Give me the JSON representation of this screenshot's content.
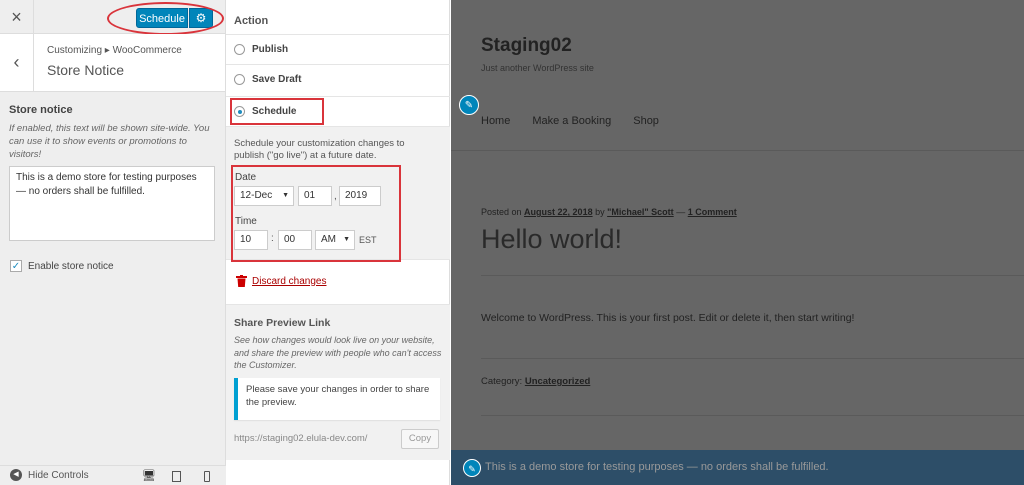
{
  "controls": {
    "close_icon": "×",
    "schedule_label": "Schedule",
    "gear_icon": "⚙",
    "back_icon": "‹",
    "breadcrumb": "Customizing ▸ WooCommerce",
    "section_title": "Store Notice",
    "store_notice_label": "Store notice",
    "store_notice_desc": "If enabled, this text will be shown site-wide. You can use it to show events or promotions to visitors!",
    "store_notice_value": "This is a demo store for testing purposes — no orders shall be fulfilled.",
    "enable_label": "Enable store notice",
    "enable_checked": true,
    "hide_controls_label": "Hide Controls"
  },
  "action": {
    "title": "Action",
    "options": [
      {
        "label": "Publish",
        "selected": false
      },
      {
        "label": "Save Draft",
        "selected": false
      },
      {
        "label": "Schedule",
        "selected": true
      }
    ],
    "schedule_desc": "Schedule your customization changes to publish (\"go live\") at a future date.",
    "date_label": "Date",
    "month": "12-Dec",
    "day": "01",
    "year": "2019",
    "time_label": "Time",
    "hour": "10",
    "minute": "00",
    "ampm": "AM",
    "timezone": "EST",
    "discard_label": "Discard changes"
  },
  "share": {
    "title": "Share Preview Link",
    "desc": "See how changes would look live on your website, and share the preview with people who can't access the Customizer.",
    "notice": "Please save your changes in order to share the preview.",
    "url": "https://staging02.elula-dev.com/",
    "copy_label": "Copy"
  },
  "preview": {
    "site_title": "Staging02",
    "tagline": "Just another WordPress site",
    "nav": [
      "Home",
      "Make a Booking",
      "Shop"
    ],
    "posted_on": "Posted on",
    "post_date": "August 22, 2018",
    "by": "by",
    "author": "\"Michael\" Scott",
    "dash": "—",
    "comments": "1 Comment",
    "post_title": "Hello world!",
    "post_body": "Welcome to WordPress. This is your first post. Edit or delete it, then start writing!",
    "category_label": "Category:",
    "category": "Uncategorized",
    "notice_bar": "This is a demo store for testing purposes — no orders shall be fulfilled."
  },
  "colors": {
    "accent": "#0085ba",
    "highlight": "#d9343b",
    "notice_bar": "#2d4e68"
  }
}
